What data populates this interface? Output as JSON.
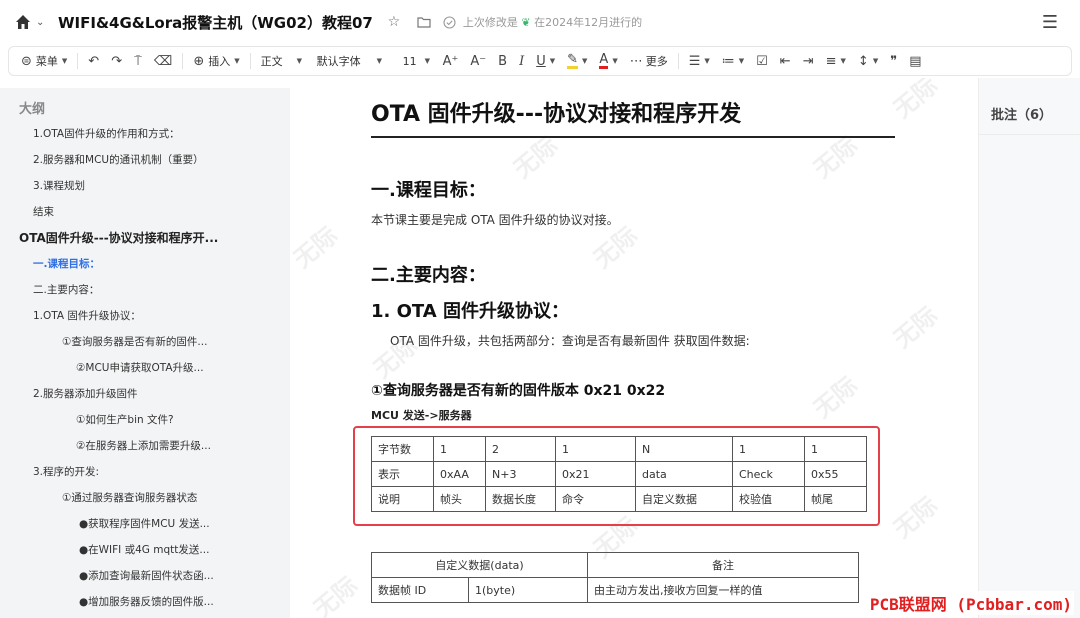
{
  "header": {
    "title": "WIFI&4G&Lora报警主机（WG02）教程07",
    "save_status": "上次修改是",
    "save_when": "在2024年12月进行的"
  },
  "toolbar": {
    "menu_label": "菜单",
    "insert_label": "插入",
    "style_label": "正文",
    "font_label": "默认字体",
    "size_label": "11",
    "more_label": "更多"
  },
  "sidebar": {
    "heading": "大纲",
    "items": [
      {
        "label": "1.OTA固件升级的作用和方式："
      },
      {
        "label": "2.服务器和MCU的通讯机制（重要）"
      },
      {
        "label": "3.课程规划"
      },
      {
        "label": "结束"
      },
      {
        "label": "OTA固件升级---协议对接和程序开..."
      },
      {
        "label": "一.课程目标："
      },
      {
        "label": "二.主要内容："
      },
      {
        "label": "1.OTA  固件升级协议："
      },
      {
        "label": "①查询服务器是否有新的固件..."
      },
      {
        "label": "②MCU申请获取OTA升级..."
      },
      {
        "label": "2.服务器添加升级固件"
      },
      {
        "label": "①如何生产bin  文件?"
      },
      {
        "label": "②在服务器上添加需要升级..."
      },
      {
        "label": "3.程序的开发:"
      },
      {
        "label": "①通过服务器查询服务器状态"
      },
      {
        "label": "●获取程序固件MCU  发送..."
      },
      {
        "label": "●在WIFI  或4G  mqtt发送..."
      },
      {
        "label": "●添加查询最新固件状态函..."
      },
      {
        "label": "●增加服务器反馈的固件版..."
      }
    ]
  },
  "doc": {
    "title": "OTA 固件升级---协议对接和程序开发",
    "sec1_title": "一.课程目标：",
    "sec1_body": "本节课主要是完成 OTA 固件升级的协议对接。",
    "sec2_title": "二.主要内容：",
    "sub1_title": "1. OTA 固件升级协议：",
    "sub1_body": "OTA 固件升级，共包括两部分：查询是否有最新固件  获取固件数据:",
    "sub2_title": "①查询服务器是否有新的固件版本 0x21  0x22",
    "direction": "MCU 发送->服务器",
    "frame_rows": [
      [
        "字节数",
        "1",
        "2",
        "1",
        "N",
        "1",
        "1"
      ],
      [
        "表示",
        "0xAA",
        "N+3",
        "0x21",
        "data",
        "Check",
        "0x55"
      ],
      [
        "说明",
        "帧头",
        "数据长度",
        "命令",
        "自定义数据",
        "校验值",
        "帧尾"
      ]
    ],
    "custom_header": [
      "自定义数据(data)",
      "备注"
    ],
    "custom_row": [
      "数据帧 ID",
      "1(byte)",
      "由主动方发出,接收方回复一样的值"
    ],
    "watermark": "无际"
  },
  "comments": {
    "label": "批注（6）"
  },
  "footer": {
    "text": "PCB联盟网 (Pcbbar.com)"
  }
}
